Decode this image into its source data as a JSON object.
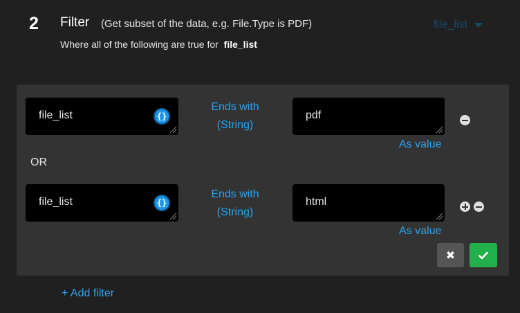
{
  "step": {
    "number": "2",
    "title": "Filter",
    "hint": "(Get subset of the data, e.g. File.Type is PDF)",
    "subtitle_prefix": "Where all of the following are true for",
    "subtitle_source": "file_list",
    "source_select": "file_list"
  },
  "conditions": [
    {
      "field": "file_list",
      "operator_line1": "Ends with",
      "operator_line2": "(String)",
      "value": "pdf",
      "value_mode": "As value"
    },
    {
      "field": "file_list",
      "operator_line1": "Ends with",
      "operator_line2": "(String)",
      "value": "html",
      "value_mode": "As value"
    }
  ],
  "joiner": "OR",
  "actions": {
    "cancel_glyph": "✖",
    "confirm_glyph": "✔"
  },
  "add_filter_label": "+ Add filter",
  "colors": {
    "background": "#202020",
    "panel": "#333333",
    "accent": "#2aa3ee",
    "confirm": "#22b04c",
    "cancel": "#555555"
  },
  "icons": [
    "vars-icon",
    "resize-grip-icon",
    "minus-circle-icon",
    "plus-circle-icon",
    "dropdown-triangle-icon",
    "close-icon",
    "check-icon"
  ]
}
